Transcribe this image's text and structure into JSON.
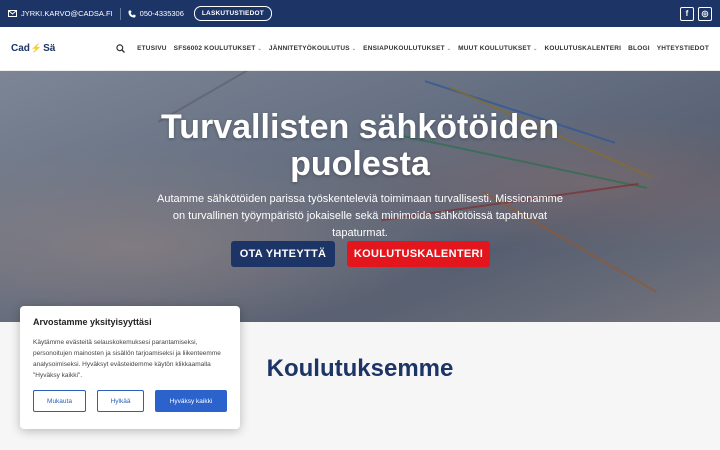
{
  "topbar": {
    "email": "JYRKI.KARVO@CADSA.FI",
    "phone": "050-4335306",
    "billing_button": "LASKUTUSTIEDOT",
    "social": [
      "f",
      "◎"
    ]
  },
  "header": {
    "logo_left": "Cad",
    "logo_mark": "⚡",
    "logo_right": "Sä",
    "nav": [
      {
        "label": "ETUSIVU",
        "dropdown": false
      },
      {
        "label": "SFS6002 KOULUTUKSET",
        "dropdown": true
      },
      {
        "label": "JÄNNITETYÖKOULUTUS",
        "dropdown": true
      },
      {
        "label": "ENSIAPUKOULUTUKSET",
        "dropdown": true
      },
      {
        "label": "MUUT KOULUTUKSET",
        "dropdown": true
      },
      {
        "label": "KOULUTUSKALENTERI",
        "dropdown": false
      },
      {
        "label": "BLOGI",
        "dropdown": false
      },
      {
        "label": "YHTEYSTIEDOT",
        "dropdown": false
      }
    ],
    "caret": "⌄"
  },
  "hero": {
    "title_line1": "Turvallisten sähkötöiden",
    "title_line2": "puolesta",
    "text": "Autamme sähkötöiden parissa työskenteleviä toimimaan turvallisesti. Missionamme on turvallinen työympäristö jokaiselle sekä minimoida sähkötöissä tapahtuvat tapaturmat.",
    "contact_button": "OTA YHTEYTTÄ",
    "calendar_button": "KOULUTUSKALENTERI"
  },
  "section": {
    "title": "Koulutuksemme"
  },
  "cookie": {
    "title": "Arvostamme yksityisyyttäsi",
    "text": "Käytämme evästeitä selauskokemuksesi parantamiseksi, personoitujen mainosten ja sisällön tarjoamiseksi ja liikenteemme analysoimiseksi. Hyväksyt evästeidemme käytön klikkaamalla \"Hyväksy kaikki\".",
    "customize": "Mukauta",
    "reject": "Hylkää",
    "accept": "Hyväksy kaikki"
  },
  "colors": {
    "brand_navy": "#1c3566",
    "brand_red": "#e3161d",
    "cookie_blue": "#2b62cc"
  }
}
